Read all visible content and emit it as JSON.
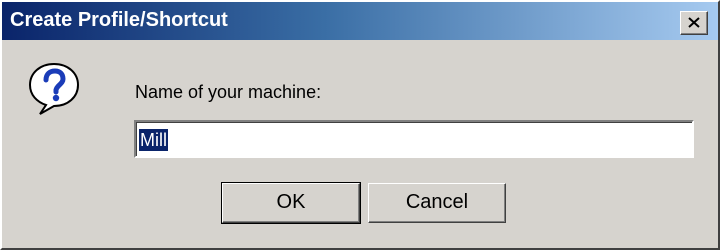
{
  "window": {
    "title": "Create Profile/Shortcut"
  },
  "dialog": {
    "prompt_label": "Name of your machine:",
    "name_field_value": "Mill",
    "icon": "question-icon"
  },
  "buttons": {
    "ok_label": "OK",
    "cancel_label": "Cancel"
  },
  "colors": {
    "title_gradient_start": "#0a246a",
    "title_gradient_end": "#a6caf0",
    "dialog_background": "#d6d3ce",
    "selection_background": "#0a246a"
  }
}
